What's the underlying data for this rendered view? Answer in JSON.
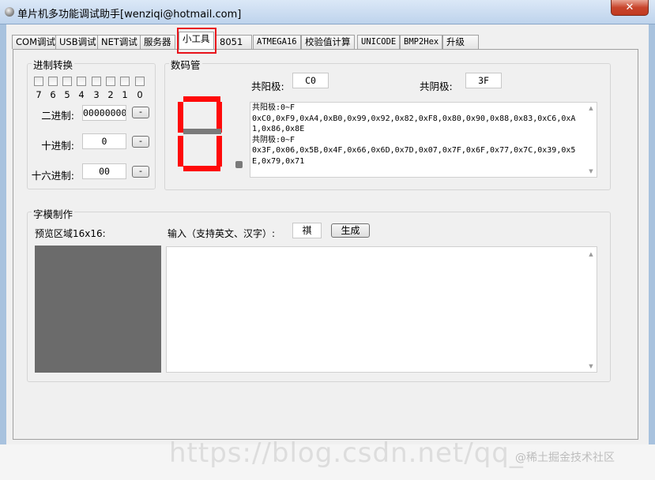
{
  "window": {
    "title": "单片机多功能调试助手[wenziqi@hotmail.com]",
    "close_icon": "✕"
  },
  "tabs": [
    {
      "label": "COM调试"
    },
    {
      "label": "USB调试"
    },
    {
      "label": "NET调试"
    },
    {
      "label": "服务器"
    },
    {
      "label": "小工具",
      "active": true
    },
    {
      "label": "8051"
    },
    {
      "label": "ATMEGA16"
    },
    {
      "label": "校验值计算"
    },
    {
      "label": "UNICODE"
    },
    {
      "label": "BMP2Hex"
    },
    {
      "label": "升级"
    }
  ],
  "base_convert": {
    "title": "进制转换",
    "bits": [
      "7",
      "6",
      "5",
      "4",
      "3",
      "2",
      "1",
      "0"
    ],
    "binary_label": "二进制:",
    "binary_value": "00000000",
    "decimal_label": "十进制:",
    "decimal_value": "0",
    "hex_label": "十六进制:",
    "hex_value": "00",
    "minus_label": "-"
  },
  "seven_segment": {
    "title": "数码管",
    "common_anode_label": "共阳极:",
    "common_anode_value": "C0",
    "common_cathode_label": "共阴极:",
    "common_cathode_value": "3F",
    "table_text": "共阳极:0~F\n0xC0,0xF9,0xA4,0xB0,0x99,0x92,0x82,0xF8,0x80,0x90,0x88,0x83,0xC6,0xA1,0x86,0x8E\n共阴极:0~F\n0x3F,0x06,0x5B,0x4F,0x66,0x6D,0x7D,0x07,0x7F,0x6F,0x77,0x7C,0x39,0x5E,0x79,0x71",
    "on_color": "#ff0a0a",
    "off_color": "#7a7a7a"
  },
  "font_maker": {
    "title": "字模制作",
    "preview_label": "预览区域16x16:",
    "input_label": "输入（支持英文、汉字）:",
    "input_value": "祺",
    "generate_label": "生成",
    "preview_color": "#6b6b6b"
  },
  "watermark": {
    "url": "https://blog.csdn.net/qq_",
    "brand": "@稀土掘金技术社区"
  }
}
